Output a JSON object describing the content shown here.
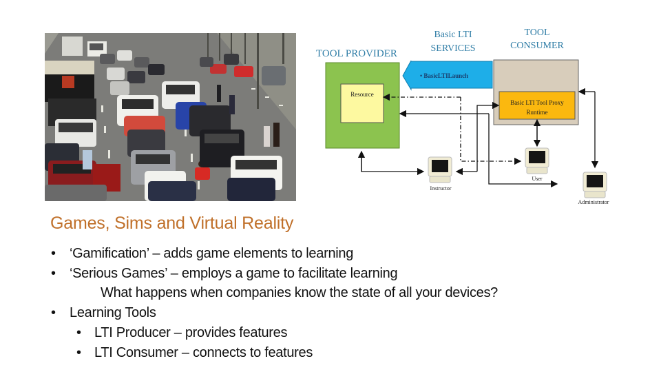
{
  "slide": {
    "title": "Games, Sims and Virtual Reality",
    "title_color": "#c0702a",
    "bullets": [
      {
        "level": 1,
        "marker": "•",
        "text": "‘Gamification’ – adds game elements to learning"
      },
      {
        "level": 1,
        "marker": "•",
        "text": "‘Serious Games’ – employs a game to facilitate learning"
      },
      {
        "level": 2,
        "marker": "",
        "text": "What happens when companies know the state of all your devices?"
      },
      {
        "level": 1,
        "marker": "•",
        "text": "Learning Tools"
      },
      {
        "level": 2,
        "marker": "•",
        "text": "LTI Producer – provides features"
      },
      {
        "level": 2,
        "marker": "•",
        "text": "LTI Consumer – connects to features"
      }
    ]
  },
  "photo": {
    "subject": "highway traffic jam photo"
  },
  "diagram": {
    "tool_provider_label": "TOOL PROVIDER",
    "services_label_line1": "Basic  LTI",
    "services_label_line2": "SERVICES",
    "tool_consumer_line1": "TOOL",
    "tool_consumer_line2": "CONSUMER",
    "launch_label": "• BasicLTILaunch",
    "resource_label": "Resource",
    "proxy_line1": "Basic LTI Tool Proxy",
    "proxy_line2": "Runtime",
    "instructor_label": "Instructor",
    "user_label": "User",
    "administrator_label": "Administrator",
    "colors": {
      "provider_green": "#8cc34f",
      "resource_yellow": "#fdf9a0",
      "arrow_blue": "#1eaee8",
      "consumer_tan": "#d8cdbb",
      "proxy_orange": "#fbb80f",
      "label_blue": "#2f7da6"
    }
  }
}
